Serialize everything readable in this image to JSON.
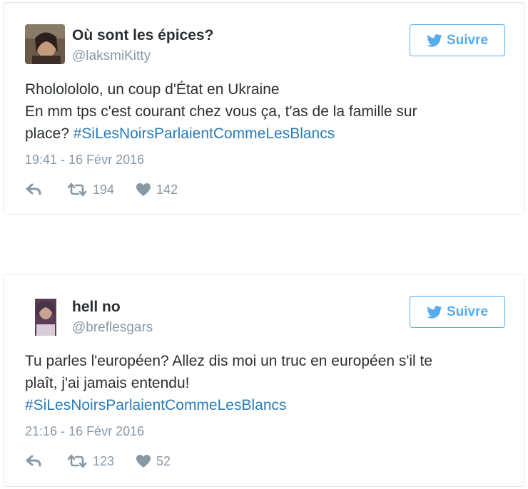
{
  "colors": {
    "text": "#292f33",
    "muted": "#8899a6",
    "link": "#2b7bb9",
    "button_blue": "#55acee",
    "border": "#e1e8ed"
  },
  "tweets": [
    {
      "display_name": "Où sont les épices?",
      "handle": "@laksmiKitty",
      "follow_label": "Suivre",
      "text_lines": [
        "Rhololololo, un coup d'État en Ukraine",
        "En mm tps c'est courant chez vous ça, t'as de la famille sur",
        "place?"
      ],
      "hashtag": "#SiLesNoirsParlaientCommeLesBlancs",
      "timestamp": "19:41 - 16 Févr 2016",
      "retweets": "194",
      "likes": "142",
      "icons": {
        "reply": "reply-icon",
        "retweet": "retweet-icon",
        "like": "heart-icon",
        "bird": "twitter-bird-icon"
      }
    },
    {
      "display_name": "hell no",
      "handle": "@breflesgars",
      "follow_label": "Suivre",
      "text_lines": [
        "Tu parles l'européen? Allez dis moi un truc en européen s'il te",
        "plaît, j'ai jamais entendu!"
      ],
      "hashtag": "#SiLesNoirsParlaientCommeLesBlancs",
      "timestamp": "21:16 - 16 Févr 2016",
      "retweets": "123",
      "likes": "52",
      "icons": {
        "reply": "reply-icon",
        "retweet": "retweet-icon",
        "like": "heart-icon",
        "bird": "twitter-bird-icon"
      }
    }
  ]
}
